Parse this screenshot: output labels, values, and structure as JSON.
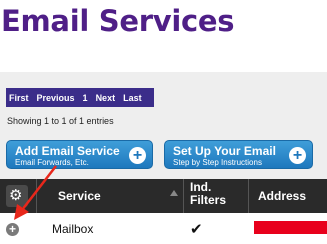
{
  "page": {
    "title": "Email Services"
  },
  "pager": {
    "first": "First",
    "previous": "Previous",
    "current": "1",
    "next": "Next",
    "last": "Last"
  },
  "entries_info": "Showing 1 to 1 of 1 entries",
  "buttons": {
    "add": {
      "label": "Add Email Service",
      "sub": "Email Forwards, Etc.",
      "icon": "plus-circle-icon"
    },
    "setup": {
      "label": "Set Up Your Email",
      "sub": "Step by Step Instructions",
      "icon": "plus-circle-icon"
    }
  },
  "table": {
    "gear_icon": "gear-icon",
    "headers": {
      "service": "Service",
      "ind_filters": "Ind. Filters",
      "address": "Address"
    },
    "rows": [
      {
        "service": "Mailbox",
        "ind_filters": "✔",
        "address_redacted": true
      }
    ]
  },
  "annotation": {
    "arrow_color": "#e8271b"
  },
  "colors": {
    "title": "#4f1f87",
    "pager": "#3b2d8a",
    "button": "#2588cb",
    "header": "#2a2a2a",
    "redaction": "#e8001c"
  }
}
